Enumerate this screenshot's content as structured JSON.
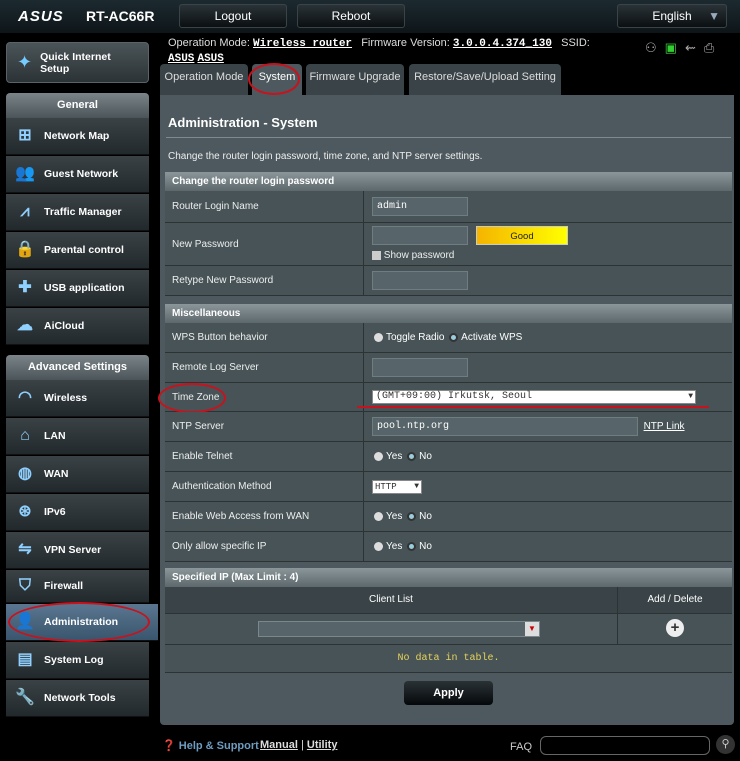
{
  "header": {
    "brand": "ASUS",
    "model": "RT-AC66R",
    "logout": "Logout",
    "reboot": "Reboot",
    "language": "English"
  },
  "status": {
    "op_mode_label": "Operation Mode:",
    "op_mode": "Wireless router",
    "fw_label": "Firmware Version:",
    "fw": "3.0.0.4.374_130",
    "ssid_label": "SSID:",
    "ssid1": "ASUS",
    "ssid2": "ASUS"
  },
  "sidebar": {
    "quick_setup": "Quick Internet Setup",
    "general": "General",
    "general_items": [
      {
        "label": "Network Map",
        "icon": "network-map-icon"
      },
      {
        "label": "Guest Network",
        "icon": "guest-network-icon"
      },
      {
        "label": "Traffic Manager",
        "icon": "traffic-manager-icon"
      },
      {
        "label": "Parental control",
        "icon": "parental-control-icon"
      },
      {
        "label": "USB application",
        "icon": "usb-icon"
      },
      {
        "label": "AiCloud",
        "icon": "cloud-icon"
      }
    ],
    "advanced": "Advanced Settings",
    "advanced_items": [
      {
        "label": "Wireless"
      },
      {
        "label": "LAN"
      },
      {
        "label": "WAN"
      },
      {
        "label": "IPv6"
      },
      {
        "label": "VPN Server"
      },
      {
        "label": "Firewall"
      },
      {
        "label": "Administration"
      },
      {
        "label": "System Log"
      },
      {
        "label": "Network Tools"
      }
    ]
  },
  "tabs": [
    "Operation Mode",
    "System",
    "Firmware Upgrade",
    "Restore/Save/Upload Setting"
  ],
  "page": {
    "title": "Administration - System",
    "description": "Change the router login password, time zone, and NTP server settings."
  },
  "password": {
    "section": "Change the router login password",
    "login_name_label": "Router Login Name",
    "login_name": "admin",
    "new_pw_label": "New Password",
    "strength": "Good",
    "show_pw": "Show password",
    "retype_label": "Retype New Password"
  },
  "misc": {
    "section": "Miscellaneous",
    "wps_label": "WPS Button behavior",
    "wps_opt1": "Toggle Radio",
    "wps_opt2": "Activate WPS",
    "remote_log_label": "Remote Log Server",
    "tz_label": "Time Zone",
    "tz_value": "(GMT+09:00) Irkutsk, Seoul",
    "ntp_label": "NTP Server",
    "ntp_value": "pool.ntp.org",
    "ntp_link": "NTP Link",
    "telnet_label": "Enable Telnet",
    "auth_label": "Authentication Method",
    "auth_value": "HTTP",
    "webaccess_label": "Enable Web Access from WAN",
    "specific_ip_label": "Only allow specific IP",
    "yes": "Yes",
    "no": "No"
  },
  "specified_ip": {
    "section": "Specified IP (Max Limit : 4)",
    "col_client": "Client List",
    "col_action": "Add / Delete",
    "empty": "No data in table."
  },
  "apply": "Apply",
  "footer": {
    "help": "Help & Support",
    "manual": "Manual",
    "sep": "|",
    "utility": "Utility",
    "faq": "FAQ"
  }
}
